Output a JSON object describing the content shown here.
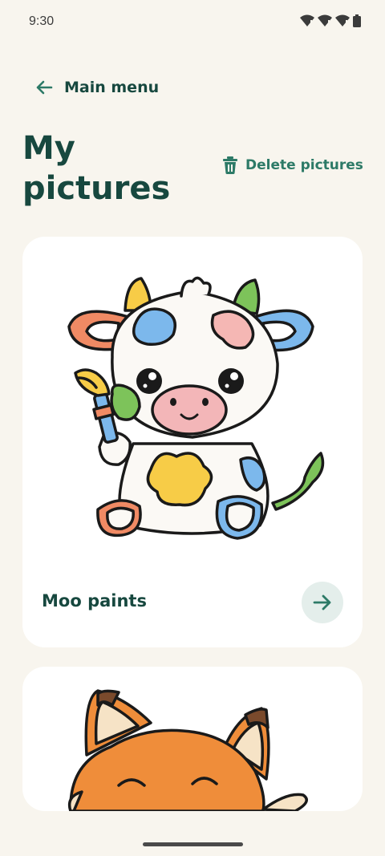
{
  "status_bar": {
    "time": "9:30"
  },
  "nav": {
    "back_label": "Main menu"
  },
  "header": {
    "title": "My pictures",
    "delete_label": "Delete pictures"
  },
  "pictures": [
    {
      "title": "Moo paints"
    },
    {
      "title": ""
    }
  ],
  "colors": {
    "background": "#f8f5ee",
    "primary_text": "#17483f",
    "accent": "#2d7a67",
    "card": "#ffffff",
    "open_button_bg": "#e4eeeb"
  }
}
